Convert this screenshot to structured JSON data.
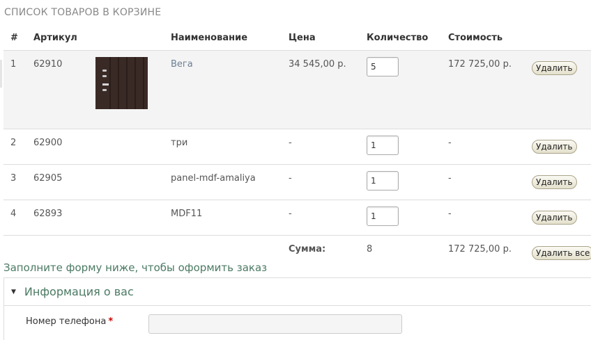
{
  "page_title": "СПИСОК ТОВАРОВ В КОРЗИНЕ",
  "table": {
    "headers": {
      "num": "#",
      "sku": "Артикул",
      "name": "Наименование",
      "price": "Цена",
      "qty": "Количество",
      "cost": "Стоимость"
    },
    "rows": [
      {
        "num": "1",
        "sku": "62910",
        "name": "Вега",
        "price": "34 545,00 р.",
        "qty": "5",
        "cost": "172 725,00 р.",
        "delete_label": "Удалить"
      },
      {
        "num": "2",
        "sku": "62900",
        "name": "три",
        "price": "-",
        "qty": "1",
        "cost": "-",
        "delete_label": "Удалить"
      },
      {
        "num": "3",
        "sku": "62905",
        "name": "panel-mdf-amaliya",
        "price": "-",
        "qty": "1",
        "cost": "-",
        "delete_label": "Удалить"
      },
      {
        "num": "4",
        "sku": "62893",
        "name": "MDF11",
        "price": "-",
        "qty": "1",
        "cost": "-",
        "delete_label": "Удалить"
      }
    ],
    "total": {
      "label": "Сумма:",
      "qty": "8",
      "cost": "172 725,00 р.",
      "delete_all_label": "Удалить все"
    }
  },
  "form": {
    "hint": "Заполните форму ниже, чтобы оформить заказ",
    "section_title": "Информация о вас",
    "phone_label": "Номер телефона",
    "required_mark": "*",
    "phone_value": ""
  },
  "colors": {
    "link": "#6b7f94",
    "accent_green": "#4b7a63",
    "required": "#cc0000"
  }
}
